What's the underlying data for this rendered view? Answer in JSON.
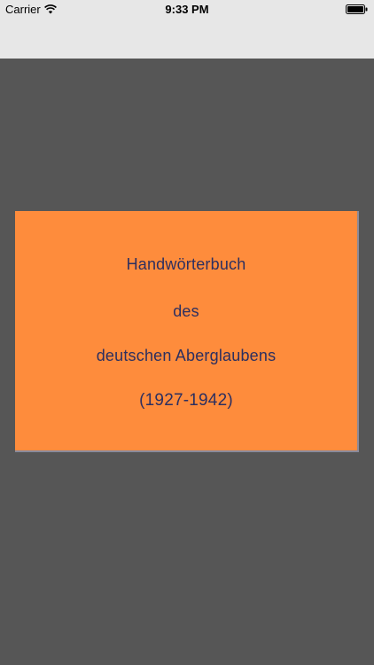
{
  "status_bar": {
    "carrier": "Carrier",
    "time": "9:33 PM",
    "wifi_icon": "wifi-icon",
    "battery_icon": "battery-icon"
  },
  "cover": {
    "line1": "Handwörterbuch",
    "line2": "des",
    "line3": "deutschen Aberglaubens",
    "line4": "(1927-1942)"
  },
  "colors": {
    "background": "#565656",
    "nav_bar": "#e7e7e7",
    "cover": "#fe8c3c",
    "cover_text": "#2c2f60"
  }
}
